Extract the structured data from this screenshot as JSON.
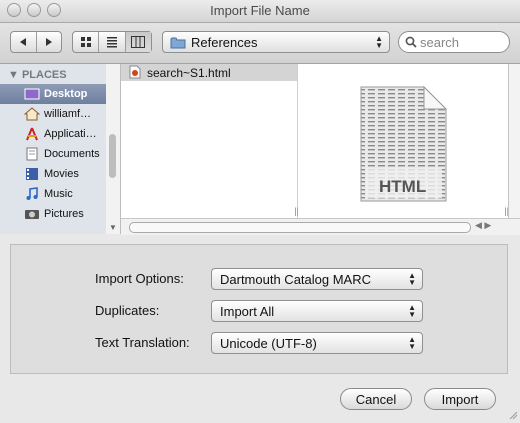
{
  "window": {
    "title": "Import File Name"
  },
  "toolbar": {
    "location": "References",
    "search_placeholder": "search"
  },
  "sidebar": {
    "header": "PLACES",
    "items": [
      {
        "label": "Desktop",
        "icon": "desktop-icon",
        "selected": true
      },
      {
        "label": "williamf…",
        "icon": "home-icon"
      },
      {
        "label": "Applicati…",
        "icon": "applications-icon"
      },
      {
        "label": "Documents",
        "icon": "documents-icon"
      },
      {
        "label": "Movies",
        "icon": "movies-icon"
      },
      {
        "label": "Music",
        "icon": "music-icon"
      },
      {
        "label": "Pictures",
        "icon": "pictures-icon"
      }
    ]
  },
  "browser": {
    "files": [
      {
        "name": "search~S1.html",
        "icon": "html-file-icon"
      }
    ],
    "preview_label": "HTML"
  },
  "options": {
    "import_options": {
      "label": "Import Options:",
      "value": "Dartmouth Catalog MARC"
    },
    "duplicates": {
      "label": "Duplicates:",
      "value": "Import All"
    },
    "text_translation": {
      "label": "Text Translation:",
      "value": "Unicode (UTF-8)"
    }
  },
  "buttons": {
    "cancel": "Cancel",
    "import": "Import"
  }
}
